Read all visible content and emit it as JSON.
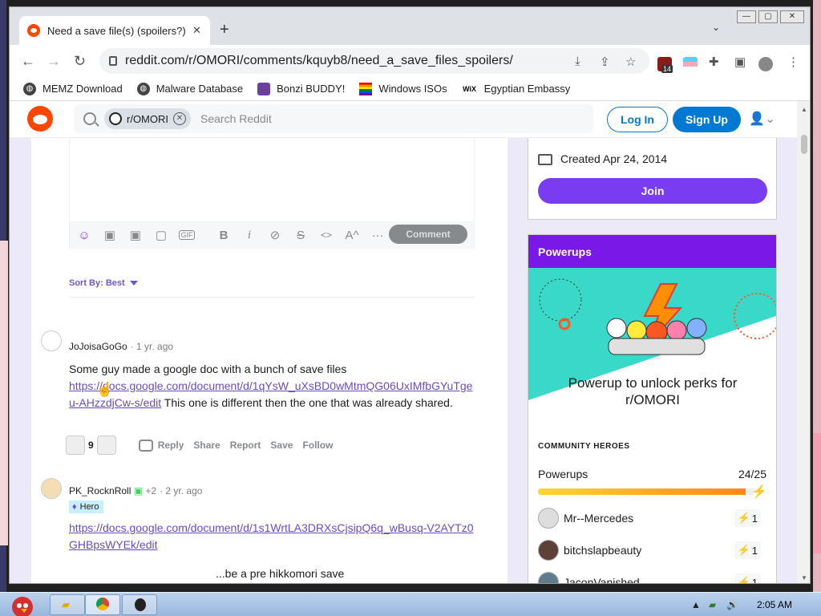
{
  "browser": {
    "tab_title": "Need a save file(s) (spoilers?) :",
    "tab_close": "✕",
    "new_tab": "+",
    "url": "reddit.com/r/OMORI/comments/kquyb8/need_a_save_files_spoilers/",
    "extension_badge": "14",
    "bookmarks": [
      {
        "label": "MEMZ Download",
        "icon": "globe-icon"
      },
      {
        "label": "Malware Database",
        "icon": "globe-icon"
      },
      {
        "label": "Bonzi BUDDY!",
        "icon": "bonzi-icon"
      },
      {
        "label": "Windows ISOs",
        "icon": "windows-flag-icon"
      },
      {
        "label": "Egyptian Embassy",
        "icon": "wix-icon"
      }
    ]
  },
  "reddit": {
    "search_chip": "r/OMORI",
    "search_placeholder": "Search Reddit",
    "login": "Log In",
    "signup": "Sign Up"
  },
  "comment_box": {
    "submit": "Comment",
    "toolbar_icons": [
      "emoji-icon",
      "sticker-icon",
      "sticker-icon",
      "sticker-icon",
      "gif-icon",
      "bold-icon",
      "italic-icon",
      "link-icon",
      "strikethrough-icon",
      "code-icon",
      "superscript-icon",
      "more-icon"
    ]
  },
  "sort": {
    "label": "Sort By: Best"
  },
  "comments": [
    {
      "author": "JoJoisaGoGo",
      "age": "· 1 yr. ago",
      "text_before": "Some guy made a google doc with a bunch of save files",
      "link": "https://docs.google.com/document/d/1qYsW_uXsBD0wMtmQG06UxIMfbGYuTgeu-AHzzdjCw-s/edit",
      "text_after": " This one is different then the one that was already shared.",
      "votes": "9",
      "actions": [
        "Reply",
        "Share",
        "Report",
        "Save",
        "Follow"
      ]
    },
    {
      "author": "PK_RocknRoll",
      "award_count": "+2",
      "age": "· 2 yr. ago",
      "flair": "Hero",
      "link": "https://docs.google.com/document/d/1s1WrtLA3DRXsCjsipQ6q_wBusq-V2AYTz0GHBpsWYEk/edit",
      "text_partial": "...be a pre hikkomori save"
    }
  ],
  "sidebar": {
    "created": "Created Apr 24, 2014",
    "join": "Join",
    "powerups_title": "Powerups",
    "powerups_text": "Powerup to unlock perks for r/OMORI",
    "heroes_title": "COMMUNITY HEROES",
    "powerups_label": "Powerups",
    "powerups_count": "24/25",
    "powerups_progress": 0.96,
    "heroes": [
      {
        "name": "Mr--Mercedes",
        "count": "1"
      },
      {
        "name": "bitchslapbeauty",
        "count": "1"
      },
      {
        "name": "JaconVanished",
        "count": "1"
      }
    ]
  },
  "taskbar": {
    "clock": "2:05 AM"
  },
  "colors": {
    "reddit_orange": "#ff4500",
    "reddit_blue": "#0079d3",
    "purple_join": "#7a3cf0",
    "powerups_header": "#7a18e8",
    "link": "#6a4bc4"
  }
}
